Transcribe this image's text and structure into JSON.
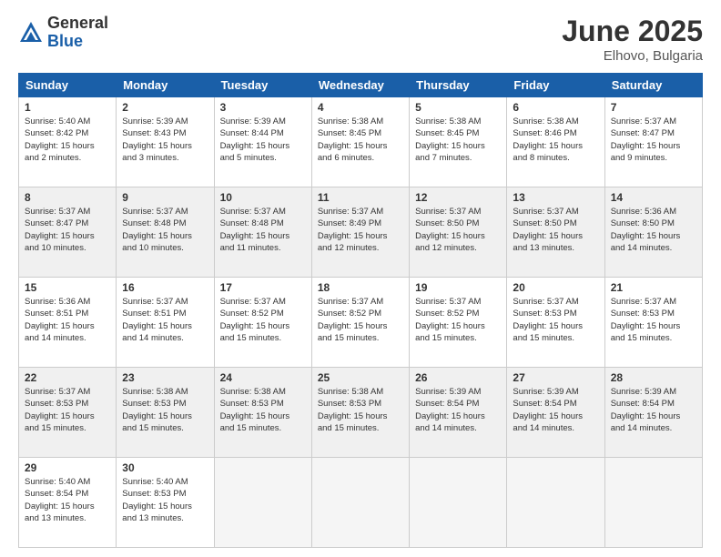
{
  "logo": {
    "general": "General",
    "blue": "Blue"
  },
  "title": "June 2025",
  "location": "Elhovo, Bulgaria",
  "days_of_week": [
    "Sunday",
    "Monday",
    "Tuesday",
    "Wednesday",
    "Thursday",
    "Friday",
    "Saturday"
  ],
  "weeks": [
    [
      {
        "day": "1",
        "sunrise": "5:40 AM",
        "sunset": "8:42 PM",
        "daylight": "15 hours and 2 minutes."
      },
      {
        "day": "2",
        "sunrise": "5:39 AM",
        "sunset": "8:43 PM",
        "daylight": "15 hours and 3 minutes."
      },
      {
        "day": "3",
        "sunrise": "5:39 AM",
        "sunset": "8:44 PM",
        "daylight": "15 hours and 5 minutes."
      },
      {
        "day": "4",
        "sunrise": "5:38 AM",
        "sunset": "8:45 PM",
        "daylight": "15 hours and 6 minutes."
      },
      {
        "day": "5",
        "sunrise": "5:38 AM",
        "sunset": "8:45 PM",
        "daylight": "15 hours and 7 minutes."
      },
      {
        "day": "6",
        "sunrise": "5:38 AM",
        "sunset": "8:46 PM",
        "daylight": "15 hours and 8 minutes."
      },
      {
        "day": "7",
        "sunrise": "5:37 AM",
        "sunset": "8:47 PM",
        "daylight": "15 hours and 9 minutes."
      }
    ],
    [
      {
        "day": "8",
        "sunrise": "5:37 AM",
        "sunset": "8:47 PM",
        "daylight": "15 hours and 10 minutes."
      },
      {
        "day": "9",
        "sunrise": "5:37 AM",
        "sunset": "8:48 PM",
        "daylight": "15 hours and 10 minutes."
      },
      {
        "day": "10",
        "sunrise": "5:37 AM",
        "sunset": "8:48 PM",
        "daylight": "15 hours and 11 minutes."
      },
      {
        "day": "11",
        "sunrise": "5:37 AM",
        "sunset": "8:49 PM",
        "daylight": "15 hours and 12 minutes."
      },
      {
        "day": "12",
        "sunrise": "5:37 AM",
        "sunset": "8:50 PM",
        "daylight": "15 hours and 12 minutes."
      },
      {
        "day": "13",
        "sunrise": "5:37 AM",
        "sunset": "8:50 PM",
        "daylight": "15 hours and 13 minutes."
      },
      {
        "day": "14",
        "sunrise": "5:36 AM",
        "sunset": "8:50 PM",
        "daylight": "15 hours and 14 minutes."
      }
    ],
    [
      {
        "day": "15",
        "sunrise": "5:36 AM",
        "sunset": "8:51 PM",
        "daylight": "15 hours and 14 minutes."
      },
      {
        "day": "16",
        "sunrise": "5:37 AM",
        "sunset": "8:51 PM",
        "daylight": "15 hours and 14 minutes."
      },
      {
        "day": "17",
        "sunrise": "5:37 AM",
        "sunset": "8:52 PM",
        "daylight": "15 hours and 15 minutes."
      },
      {
        "day": "18",
        "sunrise": "5:37 AM",
        "sunset": "8:52 PM",
        "daylight": "15 hours and 15 minutes."
      },
      {
        "day": "19",
        "sunrise": "5:37 AM",
        "sunset": "8:52 PM",
        "daylight": "15 hours and 15 minutes."
      },
      {
        "day": "20",
        "sunrise": "5:37 AM",
        "sunset": "8:53 PM",
        "daylight": "15 hours and 15 minutes."
      },
      {
        "day": "21",
        "sunrise": "5:37 AM",
        "sunset": "8:53 PM",
        "daylight": "15 hours and 15 minutes."
      }
    ],
    [
      {
        "day": "22",
        "sunrise": "5:37 AM",
        "sunset": "8:53 PM",
        "daylight": "15 hours and 15 minutes."
      },
      {
        "day": "23",
        "sunrise": "5:38 AM",
        "sunset": "8:53 PM",
        "daylight": "15 hours and 15 minutes."
      },
      {
        "day": "24",
        "sunrise": "5:38 AM",
        "sunset": "8:53 PM",
        "daylight": "15 hours and 15 minutes."
      },
      {
        "day": "25",
        "sunrise": "5:38 AM",
        "sunset": "8:53 PM",
        "daylight": "15 hours and 15 minutes."
      },
      {
        "day": "26",
        "sunrise": "5:39 AM",
        "sunset": "8:54 PM",
        "daylight": "15 hours and 14 minutes."
      },
      {
        "day": "27",
        "sunrise": "5:39 AM",
        "sunset": "8:54 PM",
        "daylight": "15 hours and 14 minutes."
      },
      {
        "day": "28",
        "sunrise": "5:39 AM",
        "sunset": "8:54 PM",
        "daylight": "15 hours and 14 minutes."
      }
    ],
    [
      {
        "day": "29",
        "sunrise": "5:40 AM",
        "sunset": "8:54 PM",
        "daylight": "15 hours and 13 minutes."
      },
      {
        "day": "30",
        "sunrise": "5:40 AM",
        "sunset": "8:53 PM",
        "daylight": "15 hours and 13 minutes."
      },
      null,
      null,
      null,
      null,
      null
    ]
  ]
}
